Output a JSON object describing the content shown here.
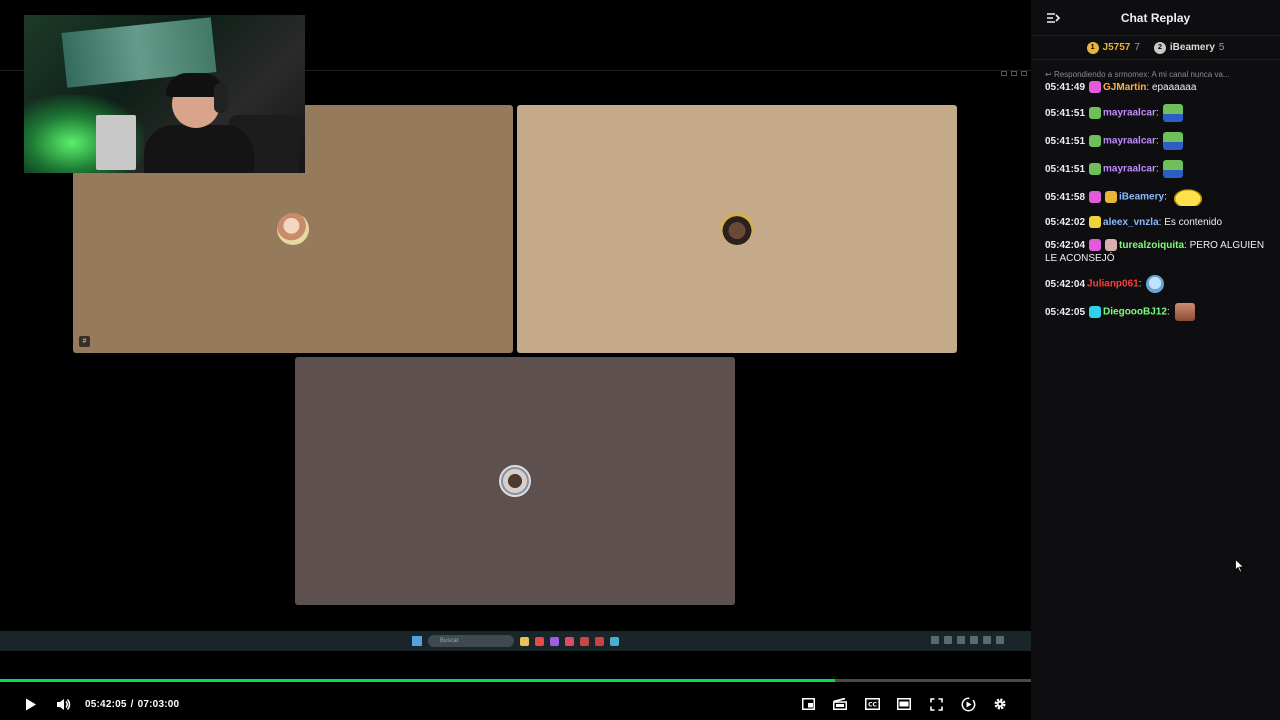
{
  "player": {
    "current_time": "05:42:05",
    "separator": "/",
    "duration": "07:03:00",
    "progress_percent": 81,
    "accent_color": "#00e04a",
    "controls": [
      "play-icon",
      "volume-icon"
    ],
    "right_controls": [
      "miniplayer-icon",
      "clip-icon",
      "closed-captions-icon",
      "theater-mode-icon",
      "fullscreen-icon",
      "playback-speed-icon",
      "settings-icon"
    ]
  },
  "stream": {
    "taskbar_search": "Buscar"
  },
  "chat": {
    "title": "Chat Replay",
    "leaderboard": [
      {
        "rank": "1",
        "name": "J5757",
        "count": "7"
      },
      {
        "rank": "2",
        "name": "iBeamery",
        "count": "5"
      }
    ],
    "reply_context": "Respondiendo a srmomex: A mi canal nunca va...",
    "messages": [
      {
        "time": "05:41:49",
        "user": "GJMartin",
        "color": "#ffb04a",
        "text": "epaaaaaa",
        "badges": [
          "#e05cd8"
        ],
        "emote": ""
      },
      {
        "time": "05:41:51",
        "user": "mayraalcar",
        "color": "#c08bff",
        "text": "",
        "badges": [
          "#6fbf5a"
        ],
        "emote": "frog"
      },
      {
        "time": "05:41:51",
        "user": "mayraalcar",
        "color": "#c08bff",
        "text": "",
        "badges": [
          "#6fbf5a"
        ],
        "emote": "frog"
      },
      {
        "time": "05:41:51",
        "user": "mayraalcar",
        "color": "#c08bff",
        "text": "",
        "badges": [
          "#6fbf5a"
        ],
        "emote": "frog"
      },
      {
        "time": "05:41:58",
        "user": "iBeamery",
        "color": "#8ab8ff",
        "text": "",
        "badges": [
          "#e05cd8",
          "#e8b43a"
        ],
        "emote": "blob"
      },
      {
        "time": "05:42:02",
        "user": "aleex_vnzla",
        "color": "#8ab8ff",
        "text": "Es contenido",
        "badges": [
          "#f0d23a"
        ],
        "emote": ""
      },
      {
        "time": "05:42:04",
        "user": "turealzoiquita",
        "color": "#7dff7a",
        "text": "PERO ALGUIEN LE ACONSEJÓ",
        "badges": [
          "#e05cd8",
          "#d9b0b0"
        ],
        "emote": ""
      },
      {
        "time": "05:42:04",
        "user": "Julianp061",
        "color": "#ff3b3b",
        "text": "",
        "badges": [],
        "emote": "cry"
      },
      {
        "time": "05:42:05",
        "user": "DiegoooBJ12",
        "color": "#7dff7a",
        "text": "",
        "badges": [
          "#2fd3e8"
        ],
        "emote": "face"
      }
    ]
  }
}
